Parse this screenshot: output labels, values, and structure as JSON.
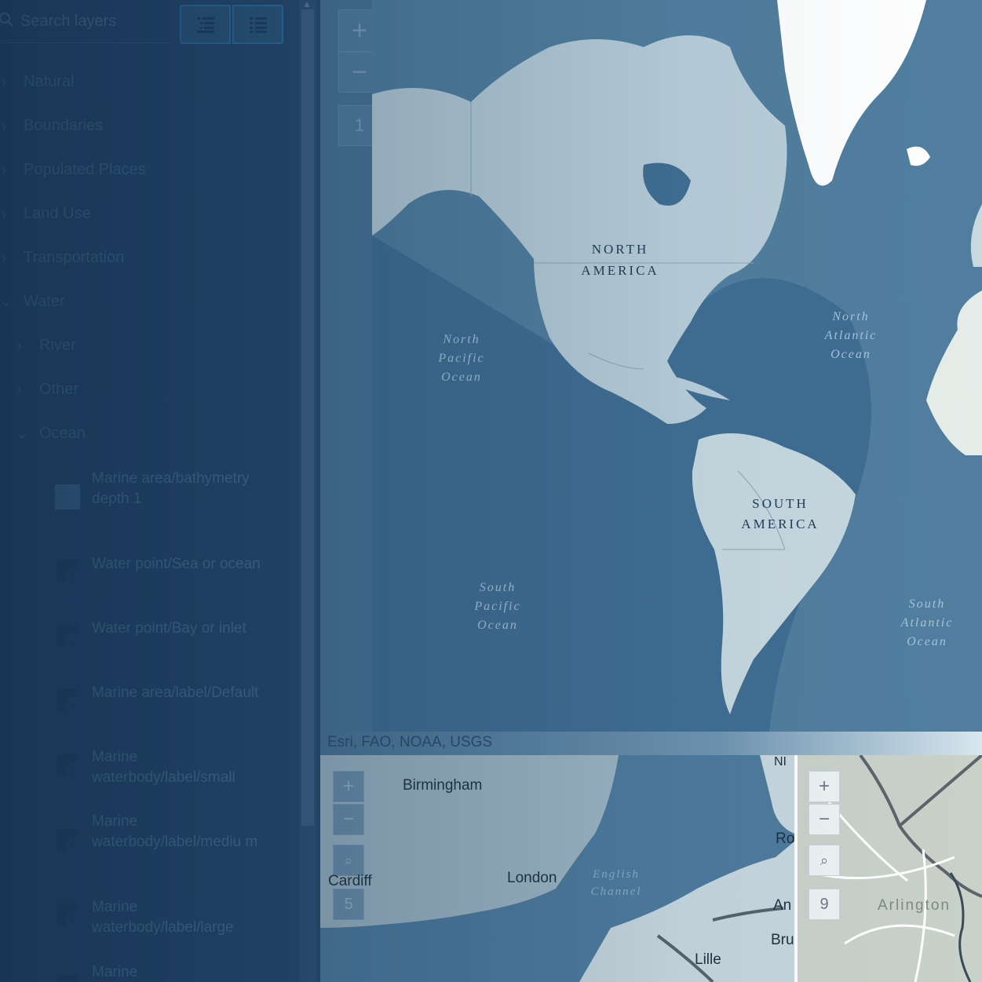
{
  "sidebar": {
    "search_placeholder": "Search layers",
    "tree": [
      {
        "label": "Natural",
        "state": "collapsed"
      },
      {
        "label": "Boundaries",
        "state": "collapsed"
      },
      {
        "label": "Populated Places",
        "state": "collapsed"
      },
      {
        "label": "Land Use",
        "state": "collapsed"
      },
      {
        "label": "Transportation",
        "state": "collapsed"
      },
      {
        "label": "Water",
        "state": "expanded"
      }
    ],
    "water_children": [
      {
        "label": "River",
        "state": "collapsed"
      },
      {
        "label": "Other",
        "state": "collapsed"
      },
      {
        "label": "Ocean",
        "state": "expanded"
      }
    ],
    "legend_items": [
      {
        "label": "Marine area/bathymetry depth 1",
        "icon": "fill-swatch"
      },
      {
        "label": "Water point/Sea or ocean",
        "icon": "label-marker"
      },
      {
        "label": "Water point/Bay or inlet",
        "icon": "label-marker"
      },
      {
        "label": "Marine area/label/Default",
        "icon": "label-marker"
      },
      {
        "label": "Marine waterbody/label/small",
        "icon": "label-marker"
      },
      {
        "label": "Marine waterbody/label/mediu m",
        "icon": "label-marker"
      },
      {
        "label": "Marine waterbody/label/large",
        "icon": "label-marker"
      },
      {
        "label": "Marine",
        "icon": "label-marker"
      }
    ]
  },
  "main_map": {
    "zoom_in": "+",
    "zoom_out": "−",
    "zoom_level": "1",
    "labels": {
      "north_america_1": "NORTH",
      "north_america_2": "AMERICA",
      "south_america_1": "SOUTH",
      "south_america_2": "AMERICA",
      "north_pacific": [
        "North",
        "Pacific",
        "Ocean"
      ],
      "north_atlantic": [
        "North",
        "Atlantic",
        "Ocean"
      ],
      "south_pacific": [
        "South",
        "Pacific",
        "Ocean"
      ],
      "south_atlantic": [
        "South",
        "Atlantic",
        "Ocean"
      ]
    },
    "attribution": "Esri, FAO, NOAA, USGS"
  },
  "mini_map_left": {
    "zoom_in": "+",
    "zoom_out": "−",
    "zoom_level": "5",
    "cities": [
      "Birmingham",
      "London",
      "Cardiff",
      "Lille",
      "Ro",
      "An",
      "Bru",
      "NI"
    ],
    "water_labels": [
      "English",
      "Channel"
    ]
  },
  "mini_map_right": {
    "zoom_in": "+",
    "zoom_out": "−",
    "zoom_level": "9",
    "place": "Arlington"
  },
  "colors": {
    "sidebar_bg": "#24476a",
    "ocean": "#3f6d92",
    "land": "#c9d8df",
    "ice": "#ffffff"
  }
}
